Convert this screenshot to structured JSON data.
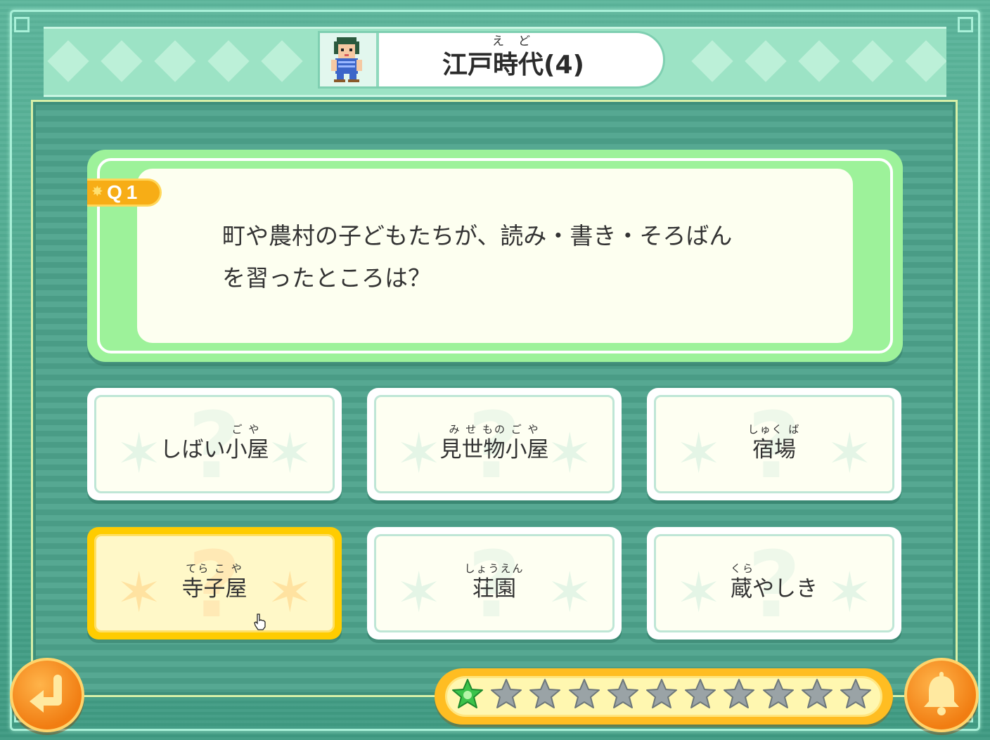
{
  "header": {
    "title_ruby": "えど",
    "title": "江戸時代(4)"
  },
  "question": {
    "badge": "Q1",
    "line1": "町や農村の子どもたちが、読み・書き・そろばん",
    "line2": "を習ったところは？"
  },
  "answers": [
    {
      "ruby": "ご や",
      "text": "しばい小屋",
      "selected": false
    },
    {
      "ruby": "み せ もの ご や",
      "text": "見世物小屋",
      "selected": false
    },
    {
      "ruby": "しゅく ば",
      "text": "宿場",
      "selected": false
    },
    {
      "ruby": "てら こ や",
      "text": "寺子屋",
      "selected": true
    },
    {
      "ruby": "しょうえん",
      "text": "荘園",
      "selected": false
    },
    {
      "ruby": "くら",
      "text": "蔵やしき",
      "selected": false
    }
  ],
  "progress": {
    "total": 11,
    "current": 1,
    "current_color": "#3cc34a",
    "pending_color": "#9aa3a6"
  },
  "icons": {
    "back": "return-arrow-icon",
    "hint": "bell-icon"
  }
}
